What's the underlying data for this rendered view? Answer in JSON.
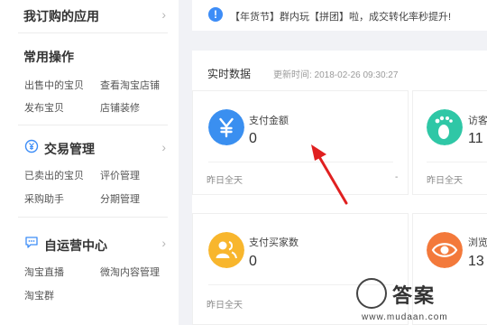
{
  "sidebar": {
    "my_apps": {
      "title": "我订购的应用"
    },
    "common_ops": {
      "title": "常用操作",
      "links": [
        "出售中的宝贝",
        "查看淘宝店铺",
        "发布宝贝",
        "店铺装修"
      ]
    },
    "trade": {
      "title": "交易管理",
      "icon": "yen-circle-icon",
      "links": [
        "已卖出的宝贝",
        "评价管理",
        "采购助手",
        "分期管理"
      ]
    },
    "self_media": {
      "title": "自运营中心",
      "icon": "chat-bubble-icon",
      "links": [
        "淘宝直播",
        "微淘内容管理",
        "淘宝群"
      ]
    }
  },
  "banner": {
    "icon": "info-icon",
    "text": "【年货节】群内玩【拼团】啦，成交转化率秒提升!"
  },
  "realtime": {
    "title": "实时数据",
    "updated": "更新时间: 2018-02-26 09:30:27",
    "cards": [
      {
        "label": "支付金额",
        "value": "0",
        "foot": "昨日全天",
        "foot_extra": "-",
        "icon": "yen-icon",
        "color": "#3a8ff0"
      },
      {
        "label": "访客",
        "value": "11",
        "foot": "昨日全天",
        "foot_extra": "",
        "icon": "footprint-icon",
        "color": "#2fc7a6"
      },
      {
        "label": "支付买家数",
        "value": "0",
        "foot": "昨日全天",
        "foot_extra": "",
        "icon": "users-icon",
        "color": "#f8b62d"
      },
      {
        "label": "浏览",
        "value": "13",
        "foot": "昨日全天",
        "foot_extra": "",
        "icon": "eye-icon",
        "color": "#f3793b"
      }
    ]
  },
  "watermark": {
    "name": "答案",
    "url": "www.mudaan.com"
  }
}
